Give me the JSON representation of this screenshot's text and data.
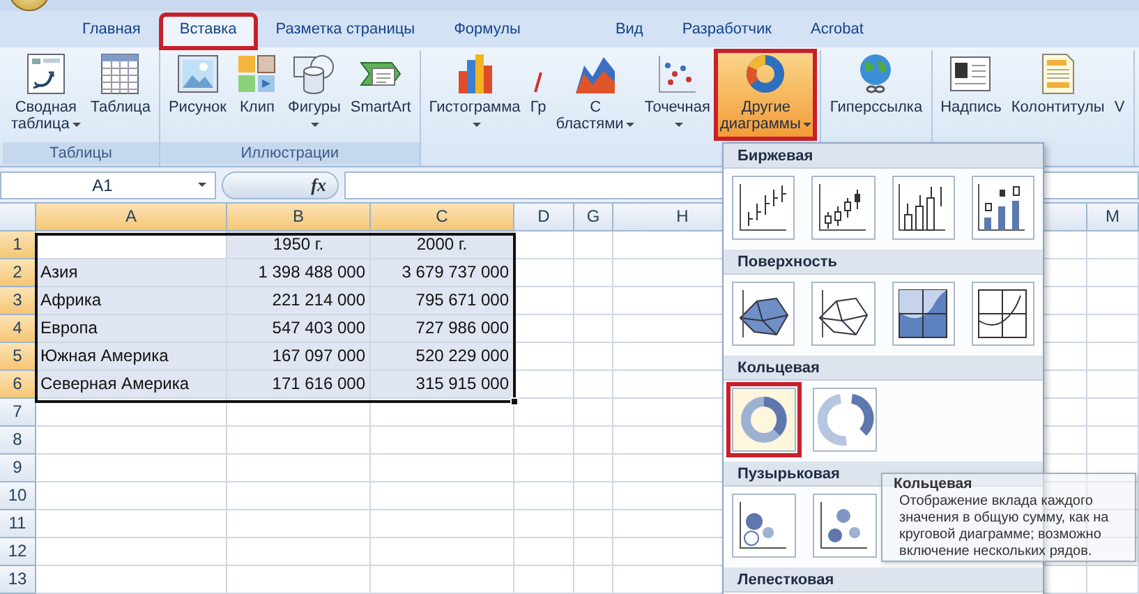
{
  "ribbon_tabs": [
    {
      "label": "Главная",
      "selected": false,
      "highlighted": false
    },
    {
      "label": "Вставка",
      "selected": true,
      "highlighted": true
    },
    {
      "label": "Разметка страницы",
      "selected": false,
      "highlighted": false
    },
    {
      "label": "Формулы",
      "selected": false,
      "highlighted": false
    },
    {
      "label": "Вид",
      "selected": false,
      "highlighted": false
    },
    {
      "label": "Разработчик",
      "selected": false,
      "highlighted": false
    },
    {
      "label": "Acrobat",
      "selected": false,
      "highlighted": false
    }
  ],
  "ribbon_groups": [
    {
      "label": "Таблицы",
      "buttons": [
        {
          "kind": "pivot",
          "lines": [
            "Сводная",
            "таблица"
          ],
          "dropdown": true,
          "highlighted": false
        },
        {
          "kind": "table",
          "lines": [
            "Таблица"
          ],
          "dropdown": false,
          "highlighted": false
        }
      ]
    },
    {
      "label": "Иллюстрации",
      "buttons": [
        {
          "kind": "picture",
          "lines": [
            "Рисунок"
          ],
          "dropdown": false,
          "highlighted": false
        },
        {
          "kind": "clip",
          "lines": [
            "Клип"
          ],
          "dropdown": false,
          "highlighted": false
        },
        {
          "kind": "shapes",
          "lines": [
            "Фигуры"
          ],
          "dropdown": true,
          "highlighted": false
        },
        {
          "kind": "smartart",
          "lines": [
            "SmartArt"
          ],
          "dropdown": false,
          "highlighted": false
        }
      ]
    },
    {
      "buttons": [
        {
          "kind": "column",
          "lines": [
            "Гистограмма"
          ],
          "dropdown": true,
          "highlighted": false
        },
        {
          "kind": "line",
          "lines": [
            "Гр"
          ],
          "dropdown": false,
          "highlighted": false
        },
        {
          "kind": "area",
          "lines": [
            "С",
            "бластями"
          ],
          "dropdown": true,
          "highlighted": false
        },
        {
          "kind": "scatter",
          "lines": [
            "Точечная"
          ],
          "dropdown": true,
          "highlighted": false
        },
        {
          "kind": "donut",
          "lines": [
            "Другие",
            "диаграммы"
          ],
          "dropdown": true,
          "highlighted": true
        }
      ]
    },
    {
      "buttons": [
        {
          "kind": "globe",
          "lines": [
            "Гиперссылка"
          ],
          "dropdown": false,
          "highlighted": false
        }
      ]
    },
    {
      "buttons": [
        {
          "kind": "textbox",
          "lines": [
            "Надпись"
          ],
          "dropdown": false,
          "highlighted": false
        },
        {
          "kind": "header",
          "lines": [
            "Колонтитулы"
          ],
          "dropdown": false,
          "highlighted": false
        },
        {
          "kind": "plain",
          "lines": [
            "V"
          ],
          "dropdown": false,
          "highlighted": false
        }
      ]
    }
  ],
  "formula_bar": {
    "name_box": "A1",
    "function_label": "fx"
  },
  "sheet": {
    "columns": [
      {
        "label": "A",
        "selected": true
      },
      {
        "label": "B",
        "selected": true
      },
      {
        "label": "C",
        "selected": true
      },
      {
        "label": "D",
        "selected": false
      },
      {
        "label": "G",
        "selected": false
      },
      {
        "label": "H",
        "selected": false
      },
      {
        "label": "M",
        "selected": false
      }
    ],
    "rows": [
      {
        "header": "1",
        "selected": true,
        "cells": [
          "",
          "1950 г.",
          "2000 г."
        ]
      },
      {
        "header": "2",
        "selected": true,
        "cells": [
          "Азия",
          "1 398 488 000",
          "3 679 737 000"
        ]
      },
      {
        "header": "3",
        "selected": true,
        "cells": [
          "Африка",
          "221 214 000",
          "795 671 000"
        ]
      },
      {
        "header": "4",
        "selected": true,
        "cells": [
          "Европа",
          "547 403 000",
          "727 986 000"
        ]
      },
      {
        "header": "5",
        "selected": true,
        "cells": [
          "Южная Америка",
          "167 097 000",
          "520 229 000"
        ]
      },
      {
        "header": "6",
        "selected": true,
        "cells": [
          "Северная Америка",
          "171 616 000",
          "315 915 000"
        ]
      },
      {
        "header": "7",
        "selected": false
      },
      {
        "header": "8",
        "selected": false
      },
      {
        "header": "9",
        "selected": false
      },
      {
        "header": "10",
        "selected": false
      },
      {
        "header": "11",
        "selected": false
      },
      {
        "header": "12",
        "selected": false
      },
      {
        "header": "13",
        "selected": false
      }
    ]
  },
  "chart_menu": {
    "sections": [
      {
        "title": "Биржевая",
        "options": [
          {
            "kind": "stock-hlc",
            "highlighted": false
          },
          {
            "kind": "stock-ohlc",
            "highlighted": false
          },
          {
            "kind": "stock-vhlc",
            "highlighted": false
          },
          {
            "kind": "stock-vohlc",
            "highlighted": false
          }
        ]
      },
      {
        "title": "Поверхность",
        "options": [
          {
            "kind": "surface",
            "highlighted": false
          },
          {
            "kind": "wireframe",
            "highlighted": false
          },
          {
            "kind": "contour",
            "highlighted": false
          },
          {
            "kind": "wire-contour",
            "highlighted": false
          }
        ]
      },
      {
        "title": "Кольцевая",
        "options": [
          {
            "kind": "donut",
            "highlighted": true
          },
          {
            "kind": "exploded-donut",
            "highlighted": false
          }
        ]
      },
      {
        "title": "Пузырьковая",
        "options": [
          {
            "kind": "bubble",
            "highlighted": false
          },
          {
            "kind": "bubble-3d",
            "highlighted": false
          }
        ]
      },
      {
        "title": "Лепестковая"
      }
    ]
  },
  "tooltip": {
    "title": "Кольцевая",
    "text": "Отображение вклада каждого значения в общую сумму, как на круговой диаграмме; возможно включение нескольких рядов."
  }
}
